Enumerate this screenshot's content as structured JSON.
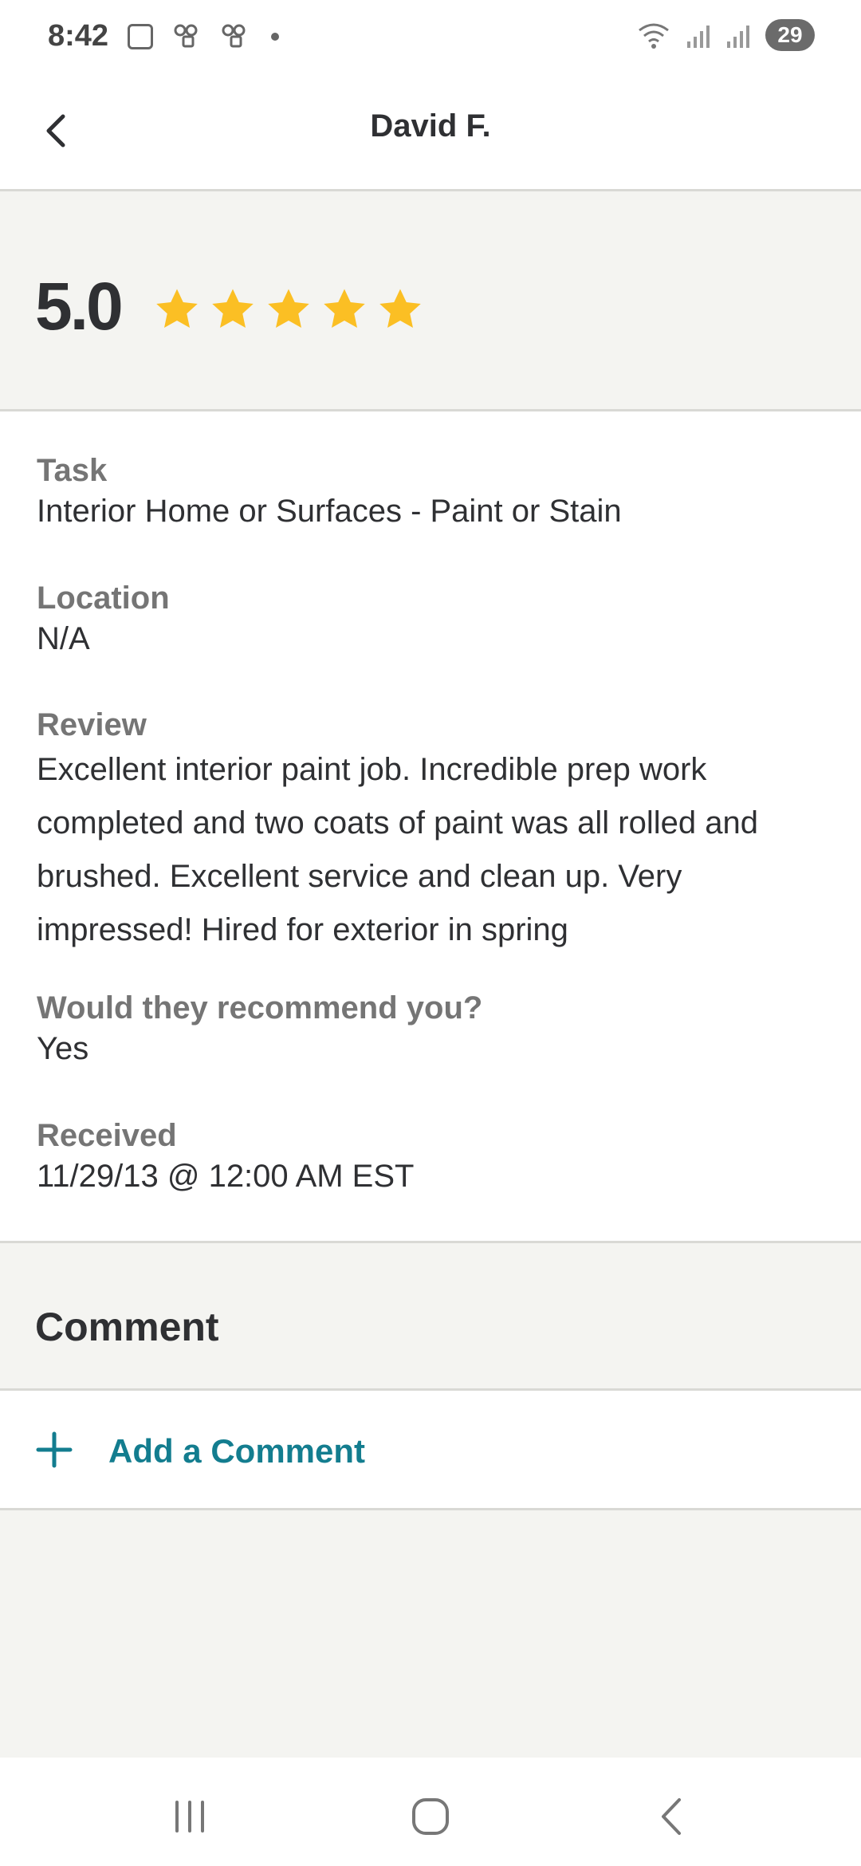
{
  "status_bar": {
    "time": "8:42",
    "battery": "29",
    "icons_left": [
      "screenshot-icon",
      "link-icon",
      "link-icon",
      "notification-dot"
    ],
    "icons_right": [
      "wifi-icon",
      "signal-icon",
      "signal-icon"
    ]
  },
  "header": {
    "title": "David F.",
    "back_icon": "chevron-left-icon"
  },
  "rating": {
    "value": "5.0",
    "stars": 5,
    "star_color": "#fbbf24"
  },
  "details": {
    "task_label": "Task",
    "task_value": "Interior Home or Surfaces - Paint or Stain",
    "location_label": "Location",
    "location_value": "N/A",
    "review_label": "Review",
    "review_value": "Excellent interior paint job.  Incredible prep work completed and two coats of paint was all rolled and brushed.  Excellent service and clean up.  Very impressed!  Hired for exterior in spring",
    "recommend_label": "Would they recommend you?",
    "recommend_value": "Yes",
    "received_label": "Received",
    "received_value": "11/29/13 @ 12:00 AM EST"
  },
  "comment": {
    "heading": "Comment",
    "add_label": "Add a Comment",
    "accent_color": "#137d8f"
  },
  "nav_bar": {
    "buttons": [
      "recent-apps-icon",
      "home-icon",
      "back-icon"
    ]
  }
}
